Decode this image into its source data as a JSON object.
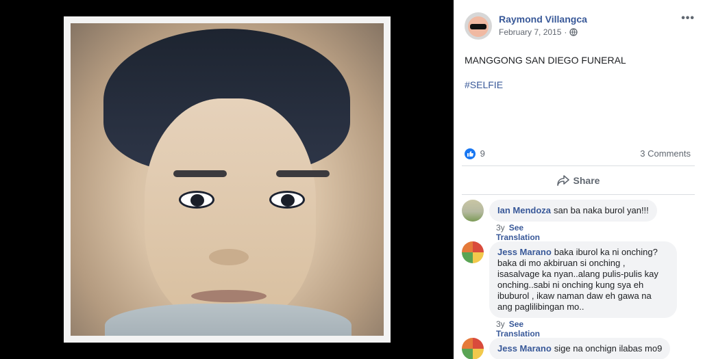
{
  "post": {
    "author": "Raymond Villangca",
    "date": "February 7, 2015",
    "separator": "·",
    "more_label": "•••",
    "text": "MANGGONG SAN DIEGO FUNERAL",
    "hashtag": "#SELFIE",
    "like_count": "9",
    "comments_count": "3 Comments",
    "share_label": "Share"
  },
  "comments": [
    {
      "name": "Ian Mendoza",
      "text": "san ba naka burol yan!!!",
      "age": "3y",
      "see_translation": "See Translation"
    },
    {
      "name": "Jess Marano",
      "text": "baka iburol ka ni onching? baka di mo akbiruan si onching , isasalvage ka nyan..alang pulis-pulis kay onching..sabi ni onching kung sya eh ibuburol , ikaw naman daw eh gawa na ang paglilibingan mo..",
      "age": "3y",
      "see_translation": "See Translation"
    },
    {
      "name": "Jess Marano",
      "text": "sige na onchign ilabas mo9",
      "age": "",
      "see_translation": ""
    }
  ],
  "colors": {
    "link": "#385898",
    "like": "#1877f2",
    "bubble": "#f2f3f5"
  }
}
